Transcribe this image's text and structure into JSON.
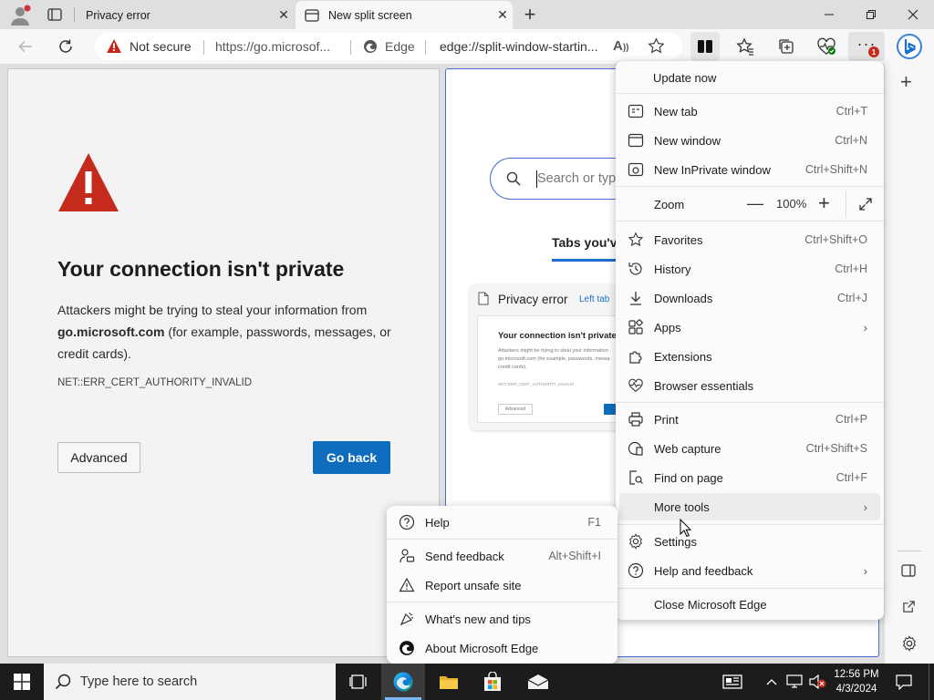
{
  "tabs": [
    {
      "title": "Privacy error",
      "active": false
    },
    {
      "title": "New split screen",
      "active": true
    }
  ],
  "address": {
    "security_label": "Not secure",
    "left_url": "https://go.microsof...",
    "edge_label": "Edge",
    "right_url": "edge://split-window-startin..."
  },
  "error_page": {
    "heading": "Your connection isn't private",
    "body_pre": "Attackers might be trying to steal your information from",
    "domain": "go.microsoft.com",
    "body_post": "(for example, passwords, messages, or credit cards).",
    "error_code": "NET::ERR_CERT_AUTHORITY_INVALID",
    "advanced_label": "Advanced",
    "go_back_label": "Go back"
  },
  "split_page": {
    "search_placeholder": "Search or type",
    "tabs_heading": "Tabs you've",
    "card_title": "Privacy error",
    "card_badge": "Left tab",
    "thumb_heading": "Your connection isn't private",
    "thumb_line1": "Attackers might be trying to steal your information",
    "thumb_line2": "go.microsoft.com (for example, passwords, messa",
    "thumb_line3": "credit cards).",
    "thumb_code": "NET::ERR_CERT_AUTHORITY_INVALID",
    "thumb_adv": "Advanced"
  },
  "main_menu": {
    "update": "Update now",
    "items": [
      {
        "label": "New tab",
        "shortcut": "Ctrl+T",
        "icon": "new-tab-icon"
      },
      {
        "label": "New window",
        "shortcut": "Ctrl+N",
        "icon": "new-window-icon"
      },
      {
        "label": "New InPrivate window",
        "shortcut": "Ctrl+Shift+N",
        "icon": "inprivate-icon"
      }
    ],
    "zoom": {
      "label": "Zoom",
      "value": "100%"
    },
    "items2": [
      {
        "label": "Favorites",
        "shortcut": "Ctrl+Shift+O",
        "icon": "favorites-icon"
      },
      {
        "label": "History",
        "shortcut": "Ctrl+H",
        "icon": "history-icon"
      },
      {
        "label": "Downloads",
        "shortcut": "Ctrl+J",
        "icon": "download-icon"
      },
      {
        "label": "Apps",
        "shortcut": "",
        "icon": "apps-icon"
      },
      {
        "label": "Extensions",
        "shortcut": "",
        "icon": "extensions-icon"
      },
      {
        "label": "Browser essentials",
        "shortcut": "",
        "icon": "heartbeat-icon"
      }
    ],
    "items3": [
      {
        "label": "Print",
        "shortcut": "Ctrl+P",
        "icon": "print-icon"
      },
      {
        "label": "Web capture",
        "shortcut": "Ctrl+Shift+S",
        "icon": "web-capture-icon"
      },
      {
        "label": "Find on page",
        "shortcut": "Ctrl+F",
        "icon": "find-icon"
      },
      {
        "label": "More tools",
        "shortcut": "",
        "icon": ""
      }
    ],
    "items4": [
      {
        "label": "Settings",
        "shortcut": "",
        "icon": "gear-icon"
      },
      {
        "label": "Help and feedback",
        "shortcut": "",
        "icon": "help-icon"
      }
    ],
    "close": "Close Microsoft Edge"
  },
  "help_submenu": {
    "items": [
      {
        "label": "Help",
        "shortcut": "F1",
        "icon": "help-icon"
      },
      {
        "label": "Send feedback",
        "shortcut": "Alt+Shift+I",
        "icon": "feedback-icon"
      },
      {
        "label": "Report unsafe site",
        "shortcut": "",
        "icon": "warning-icon"
      },
      {
        "label": "What's new and tips",
        "shortcut": "",
        "icon": "whats-new-icon"
      },
      {
        "label": "About Microsoft Edge",
        "shortcut": "",
        "icon": "edge-icon"
      }
    ]
  },
  "menu_badge": "1",
  "taskbar": {
    "search_placeholder": "Type here to search",
    "time": "12:56 PM",
    "date": "4/3/2024"
  },
  "colors": {
    "accent": "#0f6cbd",
    "warning_red": "#c42b1c",
    "pane_border": "#4b6fd1"
  }
}
